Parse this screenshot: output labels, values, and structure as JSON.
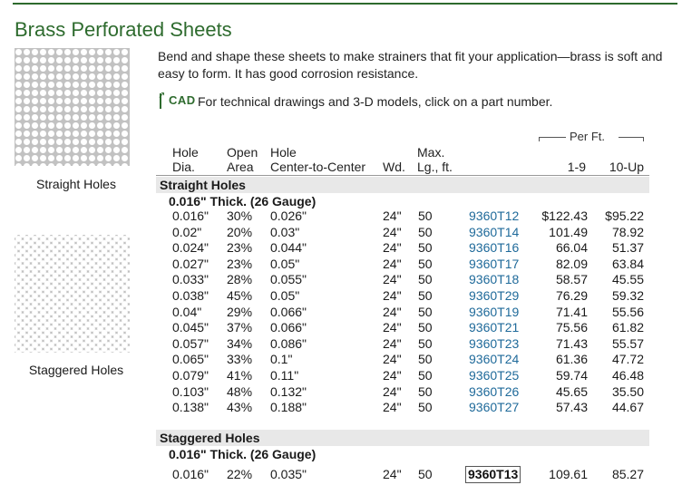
{
  "title": "Brass Perforated Sheets",
  "description": "Bend and shape these sheets to make strainers that fit your application—brass is soft and easy to form. It has good corrosion resistance.",
  "cad": {
    "icon_text": "CAD",
    "text": "For technical drawings and 3-D models, click on a part number."
  },
  "swatches": {
    "straight_label": "Straight Holes",
    "staggered_label": "Staggered Holes"
  },
  "table": {
    "per_ft_label": "Per Ft.",
    "headers": {
      "hole_dia_1": "Hole",
      "hole_dia_2": "Dia.",
      "open_area_1": "Open",
      "open_area_2": "Area",
      "ctc_1": "Hole",
      "ctc_2": "Center-to-Center",
      "wd": "Wd.",
      "max_1": "Max.",
      "max_2": "Lg., ft.",
      "p19": "1-9",
      "p10": "10-Up"
    },
    "sections": [
      {
        "title": "Straight Holes",
        "subtitle": "0.016\" Thick. (26 Gauge)",
        "rows": [
          {
            "dia": "0.016\"",
            "area": "30%",
            "ctc": "0.026\"",
            "wd": "24\"",
            "len": "50",
            "part": "9360T12",
            "p19": "$122.43",
            "p10": "$95.22"
          },
          {
            "dia": "0.02\"",
            "area": "20%",
            "ctc": "0.03\"",
            "wd": "24\"",
            "len": "50",
            "part": "9360T14",
            "p19": "101.49",
            "p10": "78.92"
          },
          {
            "dia": "0.024\"",
            "area": "23%",
            "ctc": "0.044\"",
            "wd": "24\"",
            "len": "50",
            "part": "9360T16",
            "p19": "66.04",
            "p10": "51.37"
          },
          {
            "dia": "0.027\"",
            "area": "23%",
            "ctc": "0.05\"",
            "wd": "24\"",
            "len": "50",
            "part": "9360T17",
            "p19": "82.09",
            "p10": "63.84"
          },
          {
            "dia": "0.033\"",
            "area": "28%",
            "ctc": "0.055\"",
            "wd": "24\"",
            "len": "50",
            "part": "9360T18",
            "p19": "58.57",
            "p10": "45.55"
          },
          {
            "dia": "0.038\"",
            "area": "45%",
            "ctc": "0.05\"",
            "wd": "24\"",
            "len": "50",
            "part": "9360T29",
            "p19": "76.29",
            "p10": "59.32"
          },
          {
            "dia": "0.04\"",
            "area": "29%",
            "ctc": "0.066\"",
            "wd": "24\"",
            "len": "50",
            "part": "9360T19",
            "p19": "71.41",
            "p10": "55.56"
          },
          {
            "dia": "0.045\"",
            "area": "37%",
            "ctc": "0.066\"",
            "wd": "24\"",
            "len": "50",
            "part": "9360T21",
            "p19": "75.56",
            "p10": "61.82"
          },
          {
            "dia": "0.057\"",
            "area": "34%",
            "ctc": "0.086\"",
            "wd": "24\"",
            "len": "50",
            "part": "9360T23",
            "p19": "71.43",
            "p10": "55.57"
          },
          {
            "dia": "0.065\"",
            "area": "33%",
            "ctc": "0.1\"",
            "wd": "24\"",
            "len": "50",
            "part": "9360T24",
            "p19": "61.36",
            "p10": "47.72"
          },
          {
            "dia": "0.079\"",
            "area": "41%",
            "ctc": "0.11\"",
            "wd": "24\"",
            "len": "50",
            "part": "9360T25",
            "p19": "59.74",
            "p10": "46.48"
          },
          {
            "dia": "0.103\"",
            "area": "48%",
            "ctc": "0.132\"",
            "wd": "24\"",
            "len": "50",
            "part": "9360T26",
            "p19": "45.65",
            "p10": "35.50"
          },
          {
            "dia": "0.138\"",
            "area": "43%",
            "ctc": "0.188\"",
            "wd": "24\"",
            "len": "50",
            "part": "9360T27",
            "p19": "57.43",
            "p10": "44.67"
          }
        ]
      },
      {
        "title": "Staggered Holes",
        "subtitle": "0.016\" Thick. (26 Gauge)",
        "rows": [
          {
            "dia": "0.016\"",
            "area": "22%",
            "ctc": "0.035\"",
            "wd": "24\"",
            "len": "50",
            "part": "9360T13",
            "p19": "109.61",
            "p10": "85.27"
          }
        ]
      }
    ]
  },
  "colors": {
    "title_green": "#2e6b2e",
    "link_blue": "#1f6a9a",
    "section_bar": "#e8e8e8"
  }
}
